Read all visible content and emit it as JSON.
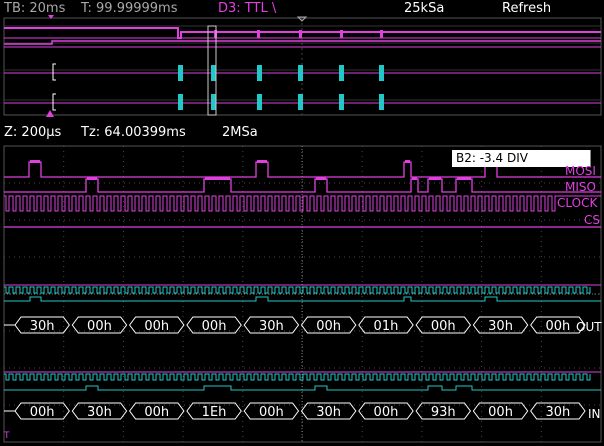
{
  "top_bar": {
    "timebase": "TB: 20ms",
    "trigger_time": "T: 99.99999ms",
    "trigger_source": "D3: TTL \\",
    "sample_rate": "25kSa",
    "refresh_label": "Refresh"
  },
  "zoom_bar": {
    "zoom": "Z: 200µs",
    "zoom_time": "Tz: 64.00399ms",
    "zoom_rate": "2MSa"
  },
  "note": "B2: -3.4 DIV",
  "channels": [
    "MOSI",
    "MISO",
    "CLOCK",
    "CS"
  ],
  "bus1": {
    "label": "OUT",
    "values": [
      "30h",
      "00h",
      "00h",
      "00h",
      "30h",
      "00h",
      "01h",
      "00h",
      "30h",
      "00h"
    ]
  },
  "bus2": {
    "label": "IN",
    "values": [
      "00h",
      "30h",
      "00h",
      "1Eh",
      "00h",
      "30h",
      "00h",
      "93h",
      "00h",
      "30h"
    ]
  },
  "trigger_marker": "T",
  "colors": {
    "digital": "#e040e0",
    "bus": "#22c8c8",
    "grid": "#4a4a4a",
    "text": "#ffffff"
  }
}
